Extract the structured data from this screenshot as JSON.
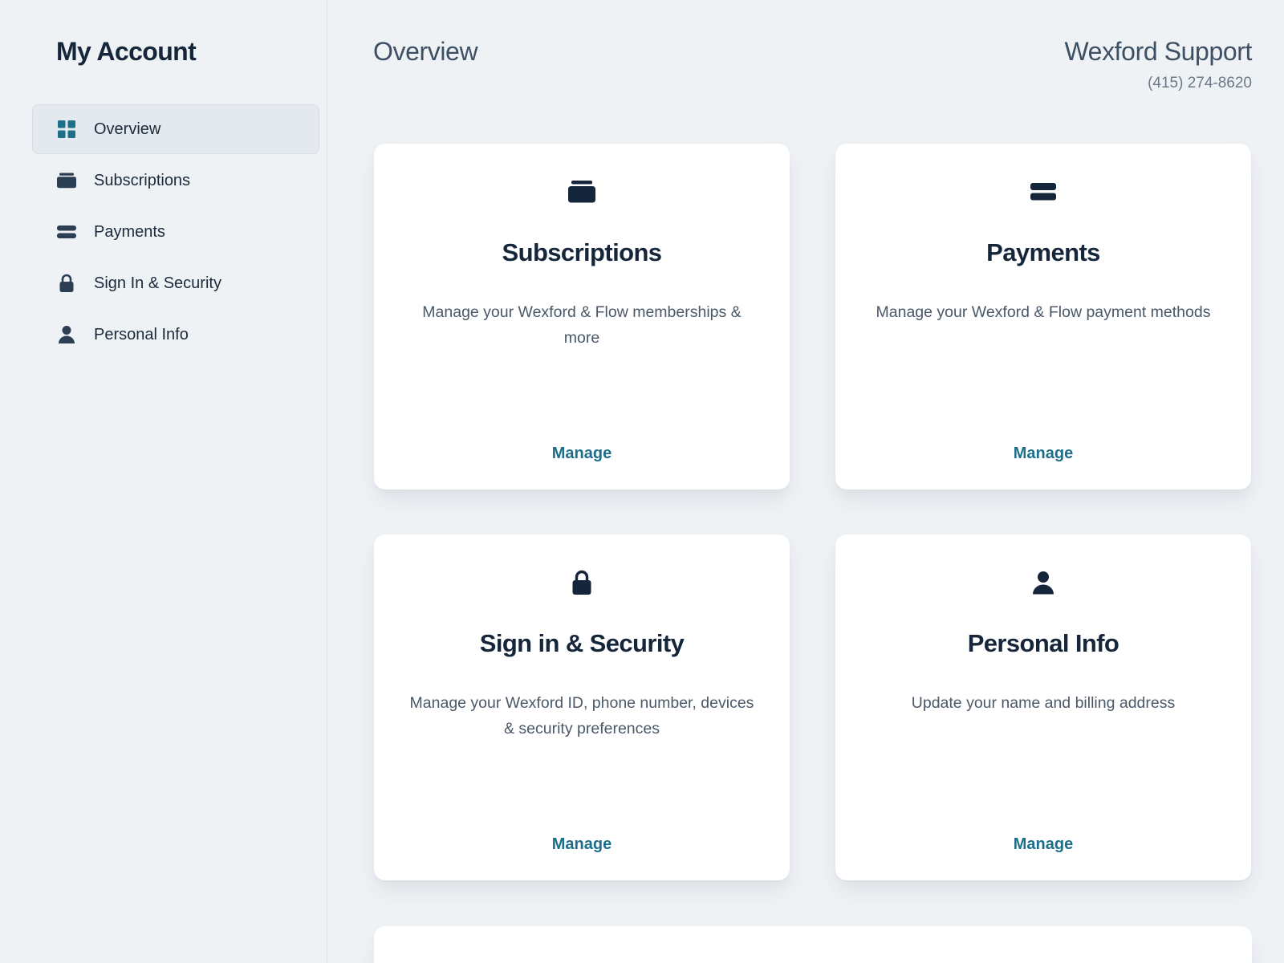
{
  "sidebar": {
    "title": "My Account",
    "items": [
      {
        "label": "Overview",
        "icon": "grid-icon",
        "active": true
      },
      {
        "label": "Subscriptions",
        "icon": "wallet-icon",
        "active": false
      },
      {
        "label": "Payments",
        "icon": "card-icon",
        "active": false
      },
      {
        "label": "Sign In & Security",
        "icon": "lock-icon",
        "active": false
      },
      {
        "label": "Personal Info",
        "icon": "user-icon",
        "active": false
      }
    ]
  },
  "header": {
    "title": "Overview",
    "support_name": "Wexford Support",
    "support_phone": "(415) 274-8620"
  },
  "cards": [
    {
      "title": "Subscriptions",
      "description": "Manage your Wexford & Flow memberships & more",
      "action": "Manage",
      "icon": "wallet-icon"
    },
    {
      "title": "Payments",
      "description": "Manage your Wexford & Flow payment methods",
      "action": "Manage",
      "icon": "card-icon"
    },
    {
      "title": "Sign in & Security",
      "description": "Manage your Wexford ID, phone number, devices & security preferences",
      "action": "Manage",
      "icon": "lock-icon"
    },
    {
      "title": "Personal Info",
      "description": "Update your name and billing address",
      "action": "Manage",
      "icon": "user-icon"
    }
  ],
  "colors": {
    "background": "#eff2f5",
    "accent": "#1c6e8a",
    "active_icon": "#1f6f8b",
    "text_dark": "#16263a"
  }
}
